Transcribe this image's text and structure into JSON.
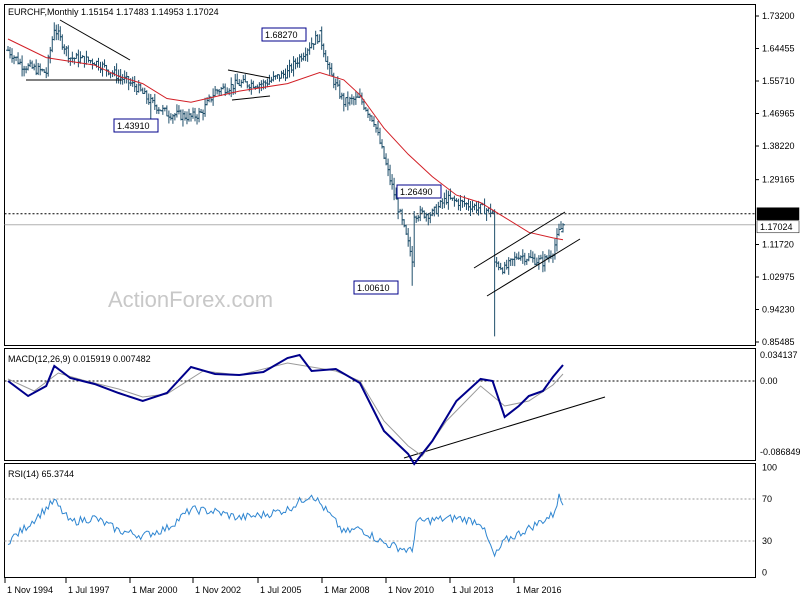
{
  "header": {
    "symbol_text": "EURCHF,Monthly  1.15154 1.17483 1.14953 1.17024",
    "watermark": "ActionForex.com"
  },
  "colors": {
    "bars": "#1f4f6b",
    "ma": "#d21f26",
    "macd": "#00008b",
    "signal": "#9a9a9a",
    "rsi": "#2f86d1",
    "trend": "#000000",
    "level_box": "#00008b"
  },
  "chart_data": [
    {
      "type": "ohlc",
      "title": "EURCHF,Monthly",
      "last_ohlc": {
        "open": 1.15154,
        "high": 1.17483,
        "low": 1.14953,
        "close": 1.17024
      },
      "x_ticks": [
        "1 Nov 1994",
        "1 Jul 1997",
        "1 Mar 2000",
        "1 Nov 2002",
        "1 Jul 2005",
        "1 Mar 2008",
        "1 Nov 2010",
        "1 Jul 2013",
        "1 Mar 2016"
      ],
      "y_ticks": [
        "1.73200",
        "1.64455",
        "1.55710",
        "1.46965",
        "1.38220",
        "1.29165",
        "1.20000",
        "1.11720",
        "1.02975",
        "0.94230",
        "0.85485"
      ],
      "ylim": [
        0.85485,
        1.732
      ],
      "annotations": [
        "1.68270",
        "1.43910",
        "1.26490",
        "1.00610"
      ],
      "levels": {
        "dashed": "1.20000",
        "last": "1.17024"
      },
      "price_path": [
        [
          "1994-11",
          1.64
        ],
        [
          "1995-06",
          1.6
        ],
        [
          "1996-06",
          1.58
        ],
        [
          "1996-10",
          1.7
        ],
        [
          "1997-06",
          1.62
        ],
        [
          "1998-06",
          1.61
        ],
        [
          "1999-06",
          1.57
        ],
        [
          "2000-03",
          1.54
        ],
        [
          "2000-10",
          1.5
        ],
        [
          "2001-06",
          1.47
        ],
        [
          "2002-06",
          1.46
        ],
        [
          "2002-11",
          1.47
        ],
        [
          "2003-06",
          1.53
        ],
        [
          "2004-06",
          1.55
        ],
        [
          "2005-06",
          1.55
        ],
        [
          "2006-06",
          1.58
        ],
        [
          "2007-06",
          1.66
        ],
        [
          "2007-10",
          1.68
        ],
        [
          "2008-03",
          1.58
        ],
        [
          "2008-10",
          1.5
        ],
        [
          "2009-06",
          1.51
        ],
        [
          "2010-01",
          1.45
        ],
        [
          "2010-06",
          1.35
        ],
        [
          "2011-08",
          1.08
        ],
        [
          "2011-09",
          1.2
        ],
        [
          "2012-06",
          1.2
        ],
        [
          "2013-01",
          1.24
        ],
        [
          "2014-06",
          1.215
        ],
        [
          "2014-12",
          1.205
        ],
        [
          "2015-01",
          1.07
        ],
        [
          "2015-06",
          1.05
        ],
        [
          "2016-01",
          1.09
        ],
        [
          "2016-06",
          1.08
        ],
        [
          "2017-01",
          1.07
        ],
        [
          "2017-06",
          1.1
        ],
        [
          "2017-09",
          1.15
        ],
        [
          "2017-11",
          1.17
        ]
      ],
      "ma_path": [
        [
          "1994-11",
          1.67
        ],
        [
          "1996-06",
          1.62
        ],
        [
          "1998-06",
          1.6
        ],
        [
          "1999-06",
          1.57
        ],
        [
          "2000-06",
          1.55
        ],
        [
          "2001-06",
          1.51
        ],
        [
          "2002-06",
          1.5
        ],
        [
          "2004-06",
          1.53
        ],
        [
          "2006-06",
          1.55
        ],
        [
          "2007-10",
          1.58
        ],
        [
          "2008-10",
          1.56
        ],
        [
          "2009-06",
          1.52
        ],
        [
          "2010-06",
          1.43
        ],
        [
          "2011-06",
          1.36
        ],
        [
          "2012-06",
          1.3
        ],
        [
          "2013-06",
          1.25
        ],
        [
          "2014-06",
          1.23
        ],
        [
          "2015-06",
          1.19
        ],
        [
          "2016-06",
          1.15
        ],
        [
          "2017-06",
          1.135
        ],
        [
          "2017-11",
          1.13
        ]
      ]
    },
    {
      "type": "line",
      "title": "MACD(12,26,9) 0.015919 0.007482",
      "y_ticks": [
        "0.034137",
        "0.00",
        "-0.086849"
      ],
      "ylim": [
        -0.086849,
        0.034137
      ],
      "series": [
        {
          "values": [
            [
              "1994-11",
              0.0
            ],
            [
              "1995-09",
              -0.015
            ],
            [
              "1996-06",
              -0.005
            ],
            [
              "1996-10",
              0.015
            ],
            [
              "1997-06",
              0.003
            ],
            [
              "1998-06",
              -0.003
            ],
            [
              "1999-06",
              -0.012
            ],
            [
              "2000-06",
              -0.02
            ],
            [
              "2001-06",
              -0.012
            ],
            [
              "2002-06",
              0.014
            ],
            [
              "2003-06",
              0.007
            ],
            [
              "2004-06",
              0.006
            ],
            [
              "2005-06",
              0.009
            ],
            [
              "2006-06",
              0.023
            ],
            [
              "2006-12",
              0.026
            ],
            [
              "2007-06",
              0.01
            ],
            [
              "2008-06",
              0.012
            ],
            [
              "2009-06",
              -0.002
            ],
            [
              "2010-06",
              -0.05
            ],
            [
              "2011-06",
              -0.073
            ],
            [
              "2011-09",
              -0.083
            ],
            [
              "2012-06",
              -0.06
            ],
            [
              "2013-06",
              -0.02
            ],
            [
              "2014-06",
              0.002
            ],
            [
              "2014-12",
              0.0
            ],
            [
              "2015-06",
              -0.036
            ],
            [
              "2016-01",
              -0.025
            ],
            [
              "2016-06",
              -0.015
            ],
            [
              "2017-01",
              -0.01
            ],
            [
              "2017-06",
              0.004
            ],
            [
              "2017-11",
              0.016
            ]
          ]
        },
        {
          "values": [
            [
              "1994-11",
              0.002
            ],
            [
              "1995-12",
              -0.01
            ],
            [
              "1996-12",
              0.008
            ],
            [
              "1997-12",
              0.001
            ],
            [
              "1999-06",
              -0.008
            ],
            [
              "2000-06",
              -0.016
            ],
            [
              "2001-06",
              -0.013
            ],
            [
              "2002-12",
              0.01
            ],
            [
              "2004-06",
              0.006
            ],
            [
              "2006-06",
              0.018
            ],
            [
              "2007-06",
              0.014
            ],
            [
              "2008-06",
              0.01
            ],
            [
              "2009-06",
              0.0
            ],
            [
              "2010-06",
              -0.04
            ],
            [
              "2011-06",
              -0.065
            ],
            [
              "2012-01",
              -0.075
            ],
            [
              "2013-01",
              -0.04
            ],
            [
              "2014-06",
              -0.005
            ],
            [
              "2015-06",
              -0.025
            ],
            [
              "2016-06",
              -0.02
            ],
            [
              "2017-06",
              -0.004
            ],
            [
              "2017-11",
              0.007
            ]
          ]
        }
      ]
    },
    {
      "type": "line",
      "title": "RSI(14) 65.3744",
      "y_ticks": [
        "100",
        "70",
        "30",
        "0"
      ],
      "ylim": [
        0,
        100
      ],
      "rsi_path": [
        [
          "1994-11",
          30
        ],
        [
          "1995-06",
          40
        ],
        [
          "1996-10",
          68
        ],
        [
          "1997-06",
          48
        ],
        [
          "1998-06",
          52
        ],
        [
          "1999-06",
          40
        ],
        [
          "2000-06",
          35
        ],
        [
          "2001-06",
          42
        ],
        [
          "2002-06",
          60
        ],
        [
          "2003-06",
          58
        ],
        [
          "2004-06",
          52
        ],
        [
          "2005-06",
          55
        ],
        [
          "2006-06",
          60
        ],
        [
          "2007-06",
          75
        ],
        [
          "2008-03",
          55
        ],
        [
          "2008-10",
          38
        ],
        [
          "2009-06",
          42
        ],
        [
          "2010-06",
          28
        ],
        [
          "2011-08",
          20
        ],
        [
          "2011-10",
          48
        ],
        [
          "2012-06",
          50
        ],
        [
          "2013-06",
          52
        ],
        [
          "2014-06",
          48
        ],
        [
          "2015-01",
          15
        ],
        [
          "2015-06",
          30
        ],
        [
          "2016-06",
          42
        ],
        [
          "2017-06",
          55
        ],
        [
          "2017-09",
          72
        ],
        [
          "2017-11",
          65
        ]
      ]
    }
  ]
}
